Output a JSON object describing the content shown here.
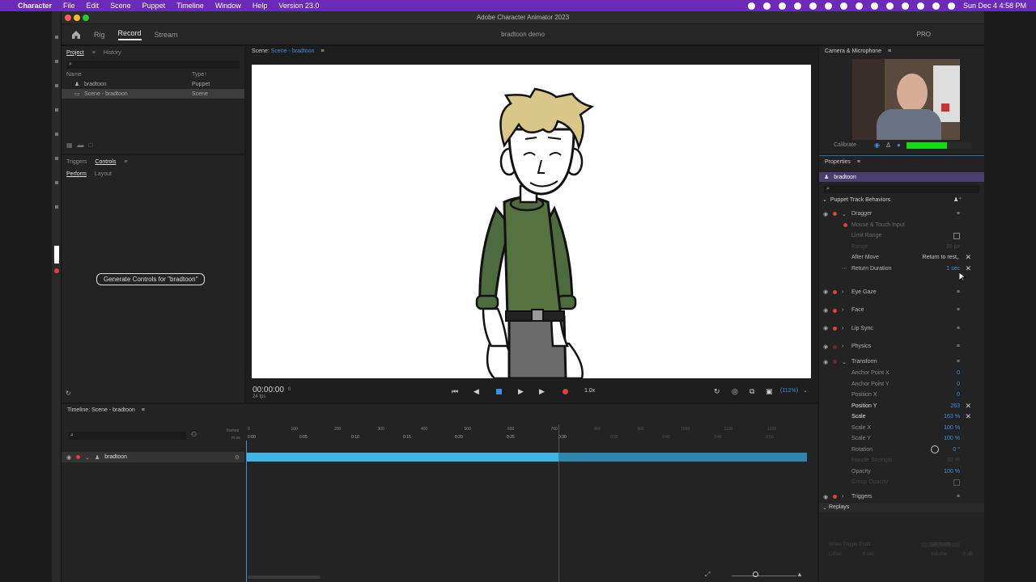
{
  "menubar": {
    "app_name": "Character",
    "items": [
      "File",
      "Edit",
      "Scene",
      "Puppet",
      "Timeline",
      "Window",
      "Help",
      "Version 23.0"
    ],
    "datetime": "Sun Dec 4  4:58 PM"
  },
  "window": {
    "title": "Adobe Character Animator 2023",
    "doc_title": "bradtoon demo",
    "modes": [
      "Rig",
      "Record",
      "Stream"
    ],
    "pro_label": "PRO"
  },
  "project": {
    "tabs": [
      "Project",
      "History"
    ],
    "col_name": "Name",
    "col_type": "Type",
    "rows": [
      {
        "name": "bradtoon",
        "type": "Puppet"
      },
      {
        "name": "Scene - bradtoon",
        "type": "Scene"
      }
    ]
  },
  "controls": {
    "tabs": [
      "Triggers",
      "Controls"
    ],
    "subtabs": [
      "Perform",
      "Layout"
    ],
    "generate_button": "Generate Controls for \"bradtoon\""
  },
  "scene": {
    "label": "Scene:",
    "name": "Scene - bradtoon",
    "timecode": "00:00:00",
    "frame": "0",
    "fps": "24 fps",
    "speed": "1.0x",
    "zoom": "(112%)"
  },
  "timeline": {
    "title": "Timeline: Scene - bradtoon",
    "frames_label": "frames",
    "mss_label": "m:ss",
    "frame_ticks": [
      "0",
      "100",
      "200",
      "300",
      "400",
      "500",
      "600",
      "700",
      "800",
      "900",
      "1000",
      "1100",
      "1200"
    ],
    "time_ticks": [
      "0:00",
      "0:05",
      "0:10",
      "0:15",
      "0:20",
      "0:25",
      "0:30",
      "0:35",
      "0:40",
      "0:45",
      "0:50"
    ],
    "track_name": "bradtoon"
  },
  "camera": {
    "title": "Camera & Microphone",
    "calibrate": "Calibrate"
  },
  "properties": {
    "title": "Properties",
    "puppet": "bradtoon",
    "section": "Puppet Track Behaviors",
    "dragger": {
      "name": "Dragger",
      "input": "Mouse & Touch Input",
      "limit_range": "Limit Range",
      "range_label": "Range",
      "range_value": "20 px",
      "after_move": "After Move",
      "after_move_value": "Return to rest",
      "return_duration": "Return Duration",
      "return_duration_value": "1 sec"
    },
    "behaviors": [
      "Eye Gaze",
      "Face",
      "Lip Sync",
      "Physics"
    ],
    "transform": {
      "name": "Transform",
      "params": [
        {
          "label": "Anchor Point X",
          "value": "0"
        },
        {
          "label": "Anchor Point Y",
          "value": "0"
        },
        {
          "label": "Position X",
          "value": "0"
        },
        {
          "label": "Position Y",
          "value": "263"
        },
        {
          "label": "Scale",
          "value": "163 %"
        },
        {
          "label": "Scale X",
          "value": "100 %"
        },
        {
          "label": "Scale Y",
          "value": "100 %"
        },
        {
          "label": "Rotation",
          "value": "0 °"
        },
        {
          "label": "Handle Strength",
          "value": "10 %"
        },
        {
          "label": "Opacity",
          "value": "100 %"
        },
        {
          "label": "Group Opacity",
          "value": ""
        }
      ]
    },
    "triggers": "Triggers",
    "replays": {
      "name": "Replays",
      "when_ends": "When Trigger Ends",
      "when_ends_value": "Let finish",
      "offset": "Offset",
      "offset_value": "0 sec",
      "volume": "Volume",
      "volume_value": "0 dB"
    }
  },
  "colors": {
    "menubar": "#6a2bb8",
    "track": "#3fb5e6",
    "record": "#e24040",
    "accent_blue": "#3c8fe0",
    "mic_level": "#16d916"
  }
}
